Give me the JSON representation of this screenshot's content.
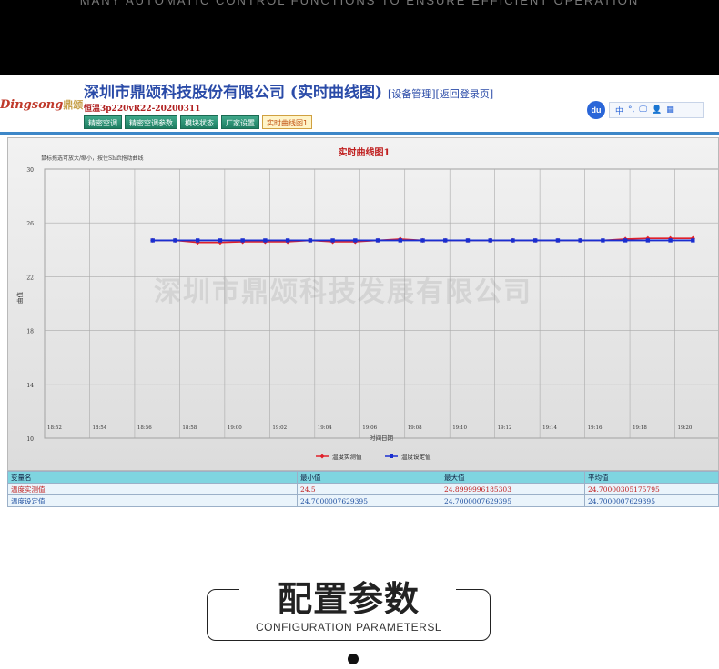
{
  "banner": {
    "caption": "MANY AUTOMATIC CONTROL FUNCTIONS TO ENSURE EFFICIENT OPERATION"
  },
  "header": {
    "logo_text": "Dingsong",
    "logo_cn": "鼎颂",
    "company": "深圳市鼎颂科技股份有限公司 (实时曲线图)",
    "link_device": "[设备管理]",
    "link_return": "[返回登录页]",
    "model": "恒温3p220vR22-20200311"
  },
  "tabs": [
    {
      "label": "精密空调"
    },
    {
      "label": "精密空调参数"
    },
    {
      "label": "模块状态"
    },
    {
      "label": "厂家设置"
    },
    {
      "label": "实时曲线图1",
      "active": true
    }
  ],
  "toolbar": {
    "du_label": "du",
    "items": [
      "中",
      "°,",
      "🖵",
      "👤",
      "▦"
    ]
  },
  "chart_data": {
    "type": "line",
    "title": "实时曲线图1",
    "hint": "鼠标拖选可放大/缩小，按住Shift拖动曲线",
    "watermark": "深圳市鼎颂科技发展有限公司",
    "xlabel": "时间日期",
    "ylabel": "曲值",
    "ylim": [
      10,
      30
    ],
    "yticks": [
      30,
      26,
      22,
      18,
      14,
      10
    ],
    "categories": [
      "18:52",
      "18:54",
      "18:56",
      "18:58",
      "19:00",
      "19:02",
      "19:04",
      "19:06",
      "19:08",
      "19:10",
      "19:12",
      "19:14",
      "19:16",
      "19:18",
      "19:20"
    ],
    "x": [
      2.4,
      2.9,
      3.4,
      3.9,
      4.4,
      4.9,
      5.4,
      5.9,
      6.4,
      6.9,
      7.4,
      7.9,
      8.4,
      8.9,
      9.4,
      9.9,
      10.4,
      10.9,
      11.4,
      11.9,
      12.4,
      12.9,
      13.4,
      13.9,
      14.4
    ],
    "series": [
      {
        "name": "温度实测值",
        "color": "#e0202a",
        "marker": "diamond",
        "values": [
          24.7,
          24.7,
          24.55,
          24.55,
          24.6,
          24.6,
          24.6,
          24.7,
          24.6,
          24.6,
          24.7,
          24.8,
          24.7,
          24.7,
          24.7,
          24.7,
          24.7,
          24.7,
          24.7,
          24.7,
          24.7,
          24.8,
          24.85,
          24.85,
          24.85
        ]
      },
      {
        "name": "温度设定值",
        "color": "#1a2ed0",
        "marker": "square",
        "values": [
          24.7,
          24.7,
          24.7,
          24.7,
          24.7,
          24.7,
          24.7,
          24.7,
          24.7,
          24.7,
          24.7,
          24.7,
          24.7,
          24.7,
          24.7,
          24.7,
          24.7,
          24.7,
          24.7,
          24.7,
          24.7,
          24.7,
          24.7,
          24.7,
          24.7
        ]
      }
    ],
    "legend": "bottom-center",
    "grid": true
  },
  "stats_table": {
    "headers": [
      "变量名",
      "最小值",
      "最大值",
      "平均值"
    ],
    "rows": [
      [
        "温度实测值",
        "24.5",
        "24.8999996185303",
        "24.70000305175795"
      ],
      [
        "温度设定值",
        "24.7000007629395",
        "24.7000007629395",
        "24.7000007629395"
      ]
    ]
  },
  "section": {
    "title": "配置参数",
    "subtitle": "CONFIGURATION PARAMETERSL"
  }
}
